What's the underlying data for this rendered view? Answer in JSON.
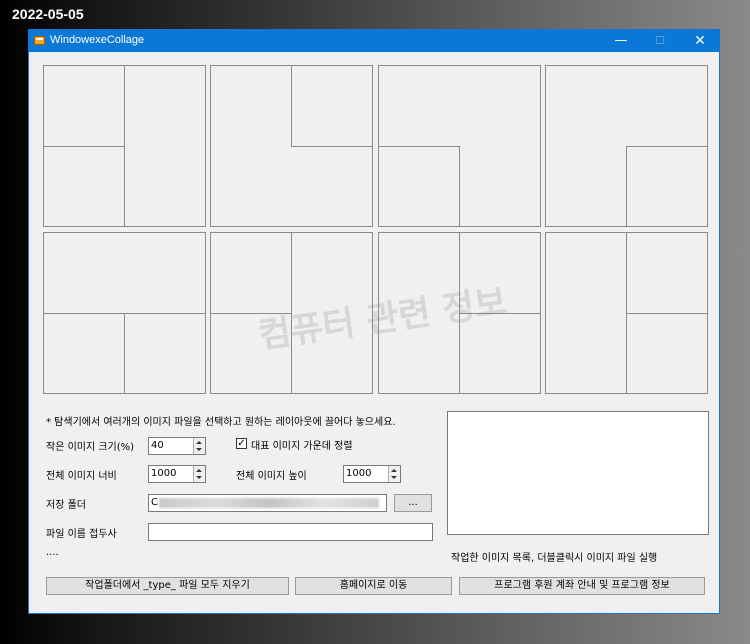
{
  "date_label": "2022-05-05",
  "window": {
    "title": "WindowexeCollage",
    "minimize": "—",
    "maximize": "☐",
    "close": "✕"
  },
  "watermark": "컴퓨터 관련 정보",
  "form": {
    "instruction": "* 탐색기에서 여러개의 이미지 파일을 선택하고 원하는 레이아웃에 끌어다 놓으세요.",
    "small_image_label": "작은 이미지 크기(%)",
    "small_image_value": "40",
    "center_check_label": "대표 이미지 가운데 정렬",
    "center_check_mark": "✓",
    "total_width_label": "전체 이미지 너비",
    "total_width_value": "1000",
    "total_height_label": "전체 이미지 높이",
    "total_height_value": "1000",
    "save_folder_label": "저장 폴더",
    "save_folder_value": "C",
    "browse_button": "...",
    "prefix_label": "파일 이름 접두사",
    "prefix_value": "",
    "dots": "....",
    "list_caption": "작업한 이미지 목록, 더블클릭시 이미지 파일 실행"
  },
  "buttons": {
    "clear_type": "작업폴더에서 _type_ 파일 모두 지우기",
    "homepage": "홈페이지로 이동",
    "sponsor_info": "프로그램 후원 계좌 안내 및 프로그램 정보"
  }
}
